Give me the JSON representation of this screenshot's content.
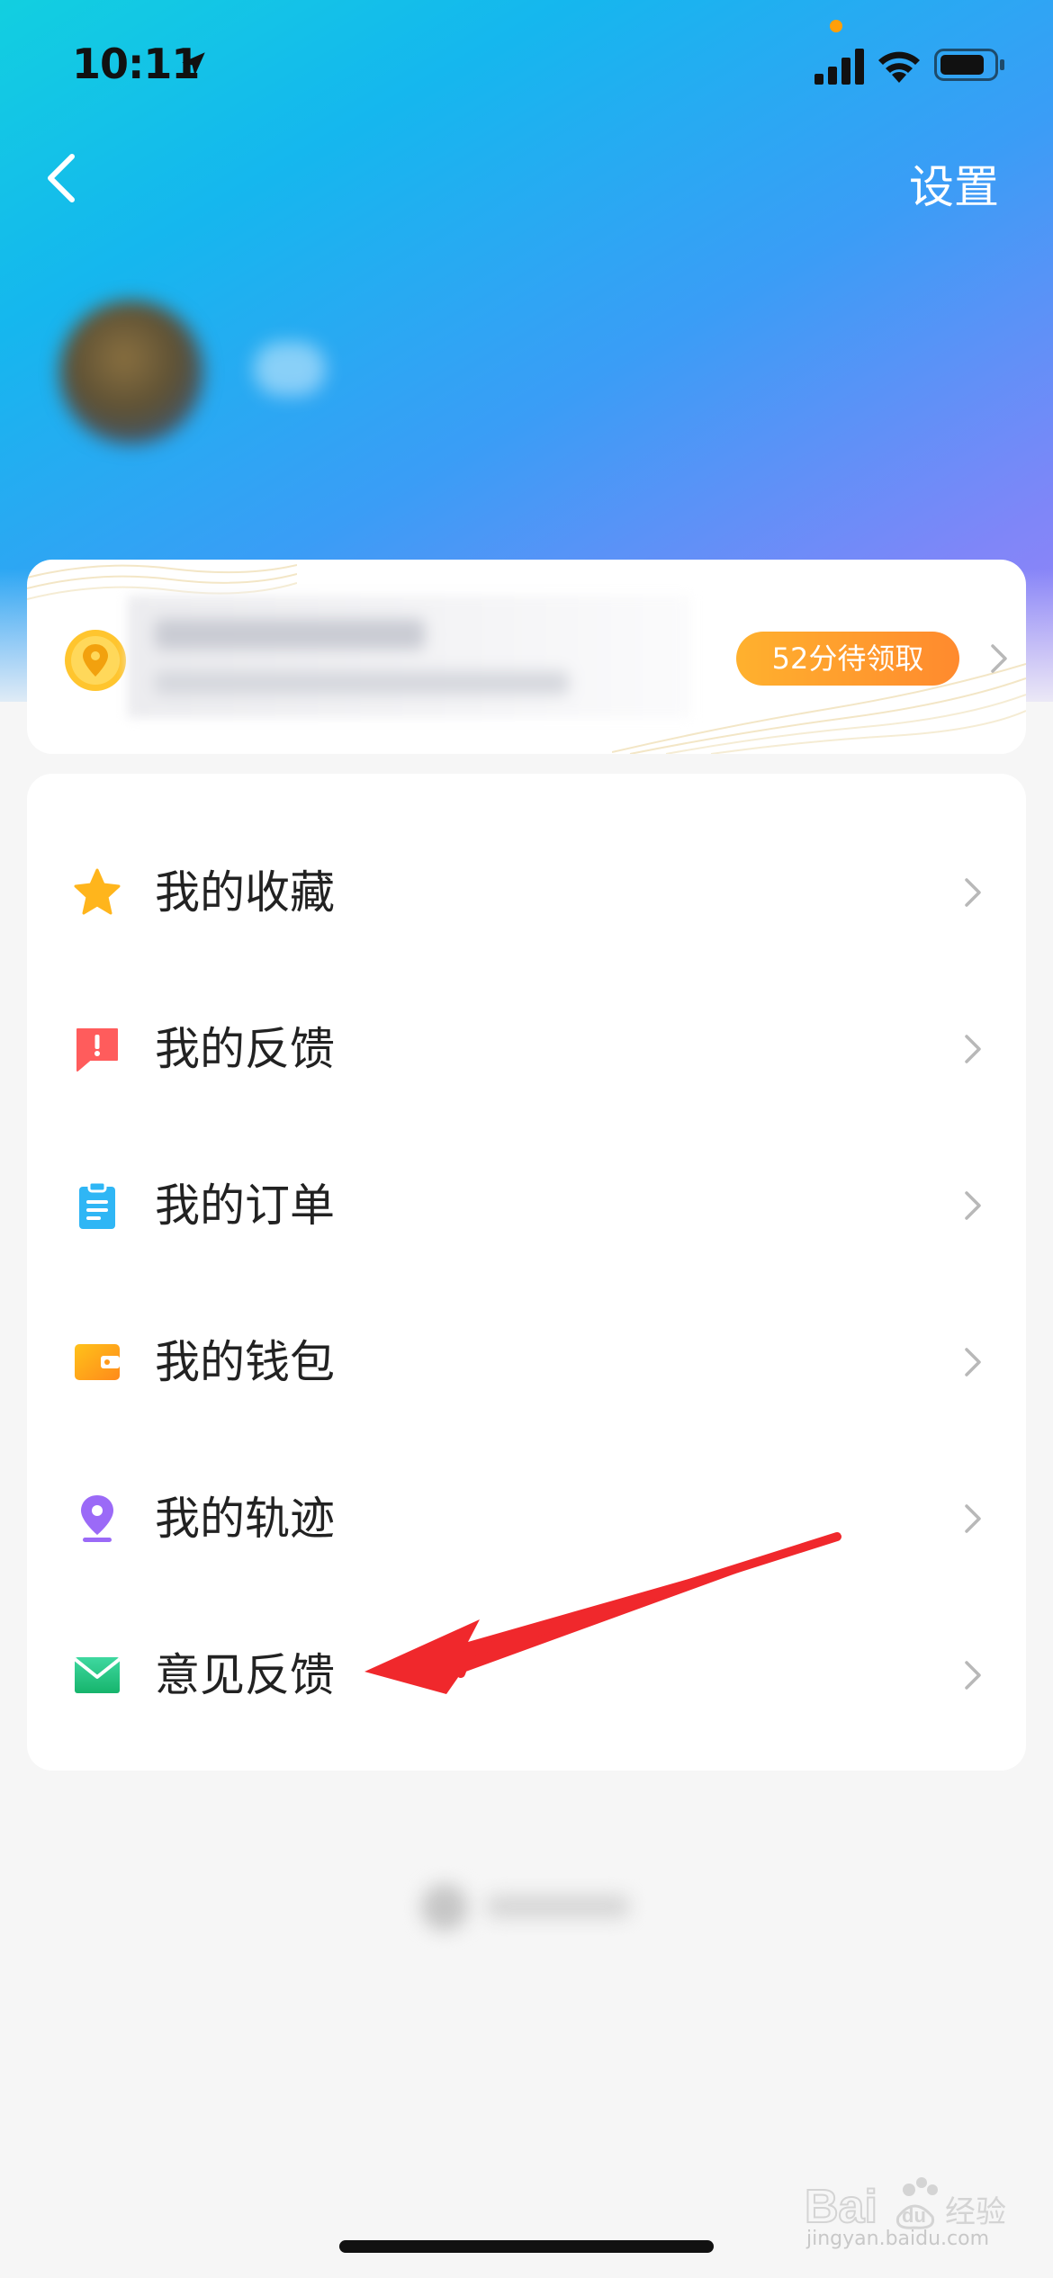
{
  "status_bar": {
    "time": "10:11",
    "colors": {
      "privacy_dot": "#ff9f0a"
    }
  },
  "nav": {
    "back_icon": "chevron-left-icon",
    "settings_label": "设置"
  },
  "colors": {
    "header_gradient": [
      "#12cfe0",
      "#3a9df6",
      "#9a82f6"
    ],
    "badge_gradient": [
      "#ffb12e",
      "#ff8a2e"
    ],
    "annotation": "#f0282c"
  },
  "points_card": {
    "icon": "coin-location-icon",
    "badge_label": "52分待领取"
  },
  "menu": {
    "items": [
      {
        "label": "我的收藏",
        "icon": "star-icon",
        "color": "#ffb51c"
      },
      {
        "label": "我的反馈",
        "icon": "feedback-alert-icon",
        "color": "#ff5c5c"
      },
      {
        "label": "我的订单",
        "icon": "clipboard-icon",
        "color": "#2fb6f5"
      },
      {
        "label": "我的钱包",
        "icon": "wallet-icon",
        "color": "#ff9a1a"
      },
      {
        "label": "我的轨迹",
        "icon": "location-pin-icon",
        "color": "#9b6af7"
      },
      {
        "label": "意见反馈",
        "icon": "envelope-icon",
        "color": "#27c47f"
      }
    ]
  },
  "watermark": {
    "text": "jingyan.baidu.com"
  }
}
